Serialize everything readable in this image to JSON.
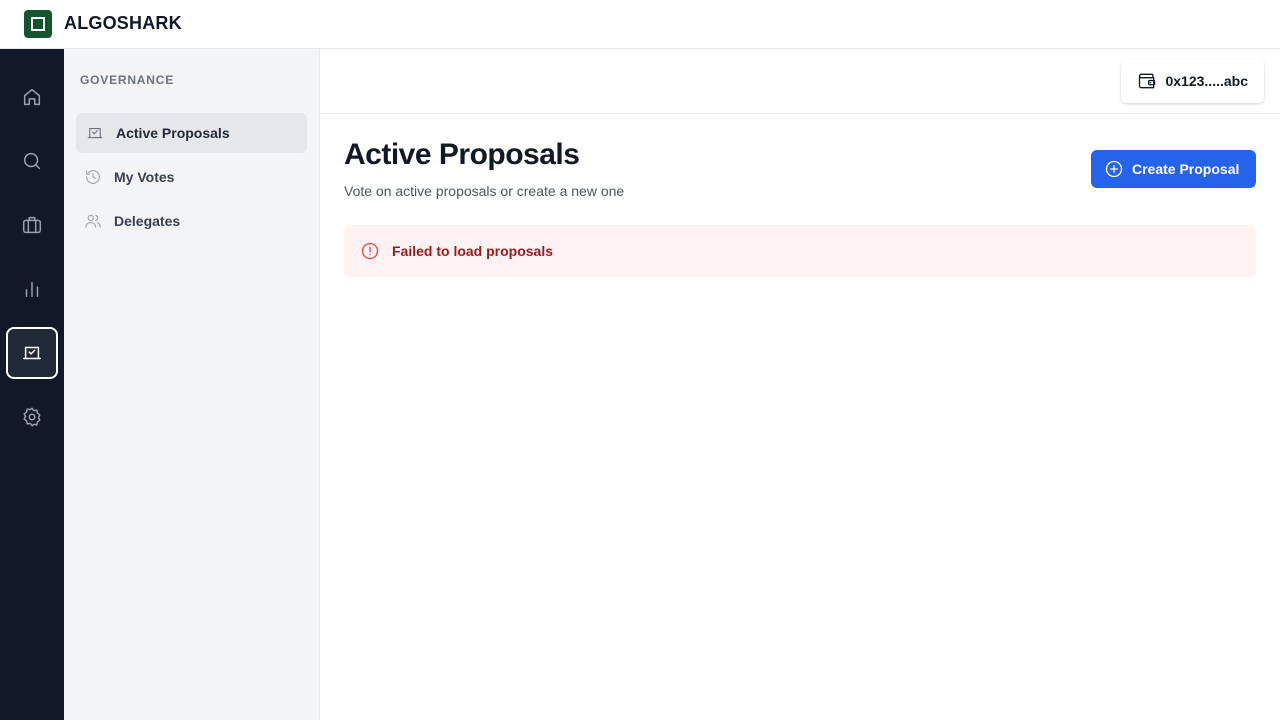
{
  "app": {
    "brand": "ALGOSHARK",
    "logo_color": "#14532d"
  },
  "rail": {
    "items": [
      {
        "icon": "home-icon",
        "label": "Home",
        "active": false
      },
      {
        "icon": "search-icon",
        "label": "Search",
        "active": false
      },
      {
        "icon": "briefcase-icon",
        "label": "Portfolio",
        "active": false
      },
      {
        "icon": "bar-chart-icon",
        "label": "Analytics",
        "active": false
      },
      {
        "icon": "vote-icon",
        "label": "Governance",
        "active": true
      },
      {
        "icon": "gear-icon",
        "label": "Settings",
        "active": false
      }
    ]
  },
  "sidebar": {
    "title": "GOVERNANCE",
    "items": [
      {
        "label": "Active Proposals",
        "icon": "vote-icon",
        "active": true
      },
      {
        "label": "My Votes",
        "icon": "history-icon",
        "active": false
      },
      {
        "label": "Delegates",
        "icon": "users-icon",
        "active": false
      }
    ]
  },
  "header": {
    "wallet_address": "0x123.....abc",
    "wallet_icon": "wallet-icon"
  },
  "main": {
    "title": "Active Proposals",
    "subtitle": "Vote on active proposals or create a new one",
    "create_button_label": "Create Proposal",
    "create_button_color": "#2563eb",
    "error_message": "Failed to load proposals",
    "error_color": "#991b1b"
  }
}
